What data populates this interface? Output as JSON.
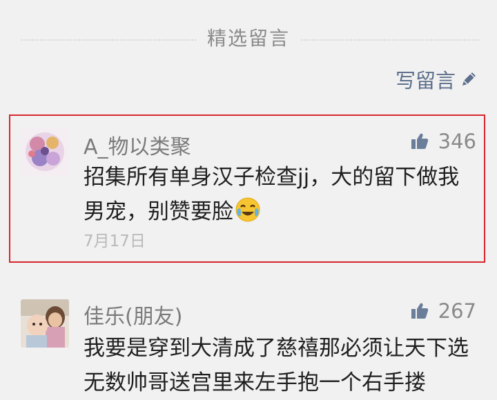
{
  "section": {
    "title": "精选留言"
  },
  "write_comment": {
    "label": "写留言"
  },
  "comments": [
    {
      "nickname": "A_物以类聚",
      "likes": "346",
      "content": "招集所有单身汉子检查jj，大的留下做我男宠，别赞要脸",
      "emoji": "face-with-tears-of-joy",
      "date": "7月17日"
    },
    {
      "nickname": "佳乐(朋友)",
      "likes": "267",
      "content": "我要是穿到大清成了慈禧那必须让天下选无数帅哥送宫里来左手抱一个右手搂"
    }
  ],
  "colors": {
    "highlight": "#d8252b",
    "link": "#5c6f8b",
    "background": "#f1f1f1"
  }
}
